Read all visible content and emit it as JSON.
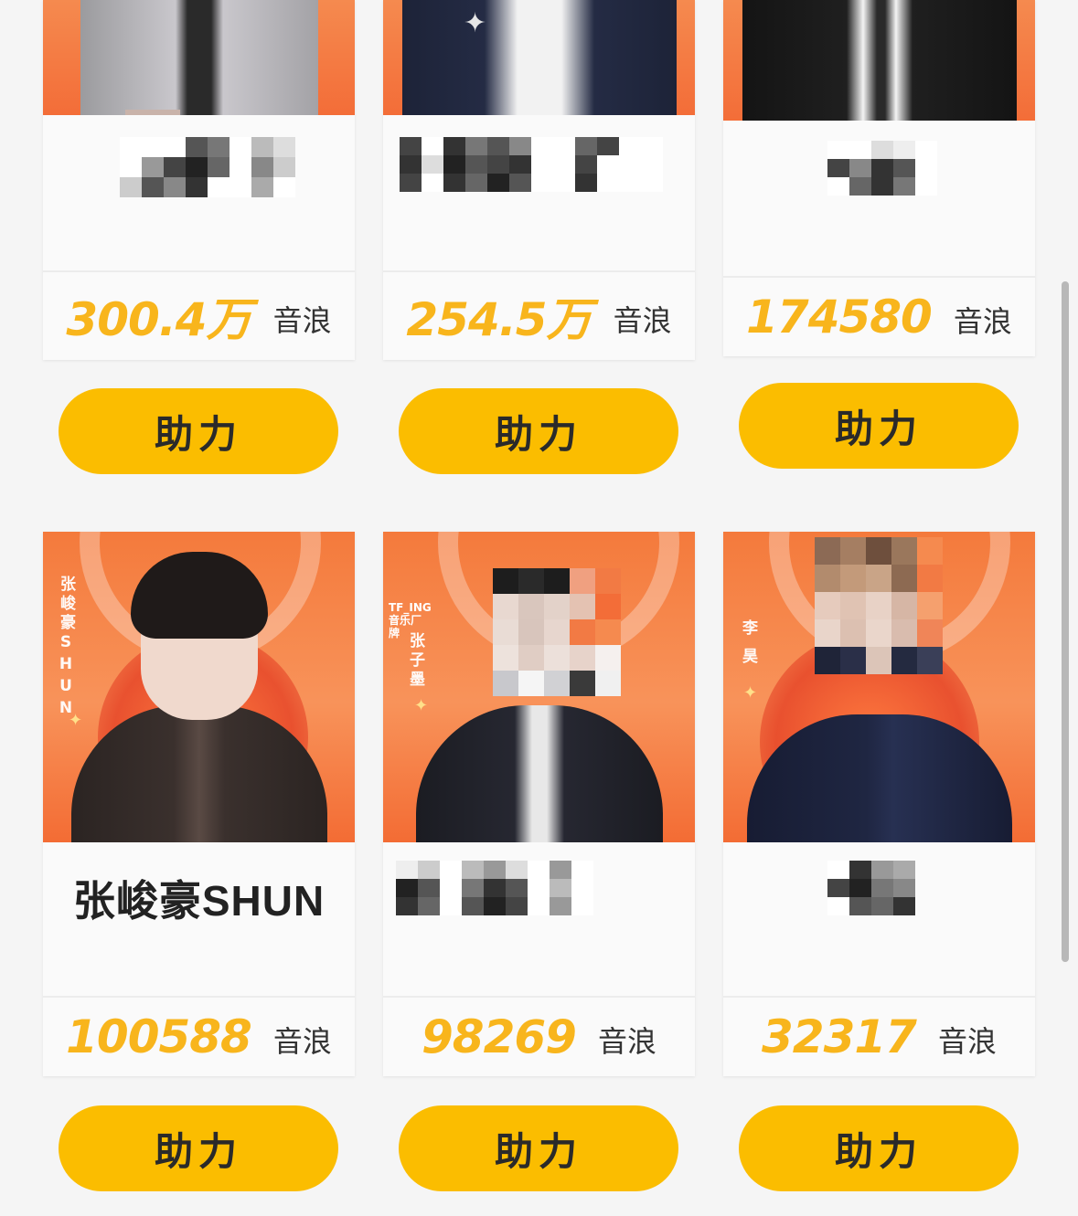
{
  "colors": {
    "accent": "#fbbd00",
    "score": "#f8b51c",
    "photo_bg": "#f47a3c",
    "page_bg": "#f5f5f5"
  },
  "cards": [
    {
      "name": "",
      "score": "300.4万",
      "unit": "音浪",
      "button": "助力",
      "name_obscured": true
    },
    {
      "name": "",
      "score": "254.5万",
      "unit": "音浪",
      "button": "助力",
      "name_obscured": true
    },
    {
      "name": "",
      "score": "174580",
      "unit": "音浪",
      "button": "助力",
      "name_obscured": true
    },
    {
      "name": "张峻豪SHUN",
      "score": "100588",
      "unit": "音浪",
      "button": "助力",
      "name_obscured": false,
      "photo_label": "张峻豪SHUN"
    },
    {
      "name": "",
      "score": "98269",
      "unit": "音浪",
      "button": "助力",
      "name_obscured": true,
      "photo_label": "张子墨",
      "photo_tag": "TF_ING 音乐厂牌"
    },
    {
      "name": "",
      "score": "32317",
      "unit": "音浪",
      "button": "助力",
      "name_obscured": true,
      "photo_label": "李昊"
    }
  ],
  "icons": {
    "sparkle": "sparkle-icon",
    "scrollbar": "scrollbar"
  }
}
